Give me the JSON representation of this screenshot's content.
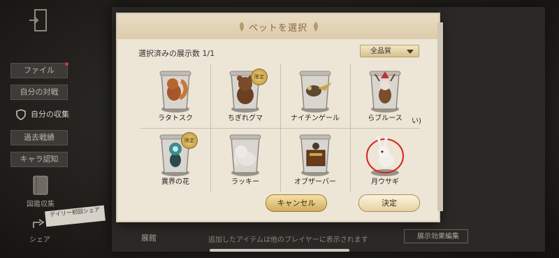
{
  "dialog": {
    "title": "ペットを選択",
    "count_label": "選択済みの展示数 1/1",
    "filter": {
      "selected": "全品質"
    },
    "cancel_label": "キャンセル",
    "ok_label": "決定"
  },
  "pets": [
    {
      "name": "ラタトスク",
      "icon": "squirrel-icon",
      "badge": "",
      "selected": false
    },
    {
      "name": "ちぎれグマ",
      "icon": "bear-icon",
      "badge": "限定",
      "selected": false
    },
    {
      "name": "ナイチンゲール",
      "icon": "nightingale-icon",
      "badge": "",
      "selected": false
    },
    {
      "name": "らブルース",
      "icon": "reindeer-icon",
      "badge": "",
      "selected": false
    },
    {
      "name": "異界の花",
      "icon": "flower-icon",
      "badge": "限定",
      "selected": false
    },
    {
      "name": "ラッキー",
      "icon": "elephant-icon",
      "badge": "",
      "selected": false
    },
    {
      "name": "オブザーバー",
      "icon": "observer-icon",
      "badge": "",
      "selected": false
    },
    {
      "name": "月ウサギ",
      "icon": "rabbit-icon",
      "badge": "",
      "selected": true
    }
  ],
  "extra_mark": "い)",
  "sidebar": {
    "items": [
      {
        "label": "ファイル"
      },
      {
        "label": "自分の対戦"
      },
      {
        "label": "自分の収集"
      },
      {
        "label": "過去戦績"
      },
      {
        "label": "キャラ認知"
      }
    ],
    "book_label": "図鑑収集",
    "share_label": "シェア",
    "daily_tag": "デイリー初回シェア"
  },
  "bottom": {
    "tab_label": "展館",
    "note": "追加したアイテムは他のプレイヤーに表示されます",
    "settings_button": "展示効果編集"
  },
  "colors": {
    "accent": "#d2ac5c",
    "dialog_bg": "#ede5d6",
    "selection_ring": "#d22222"
  }
}
